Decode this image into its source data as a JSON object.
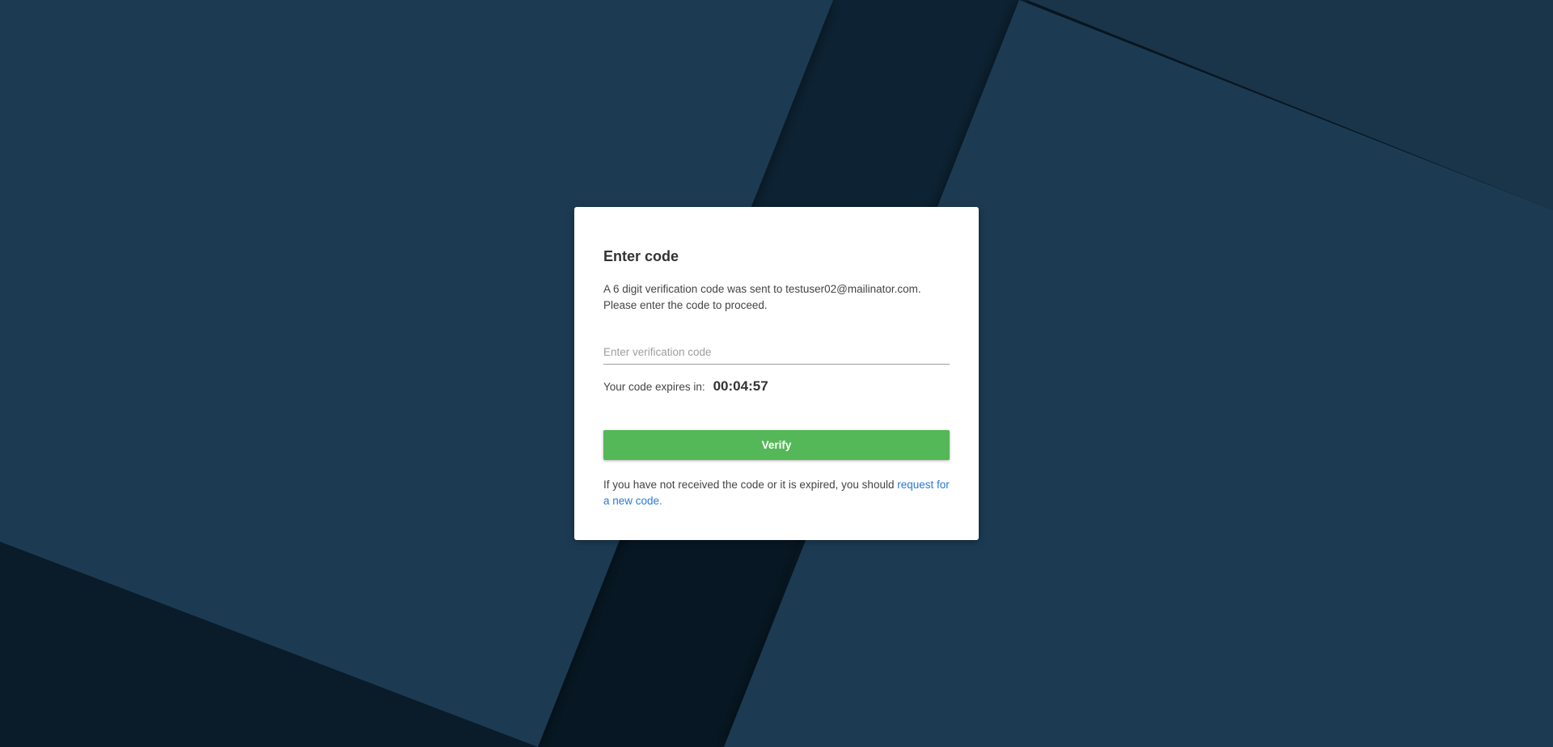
{
  "background": {
    "colors": {
      "base": "#1c3a52",
      "dark": "#0a1c29",
      "darker": "#06131c"
    }
  },
  "verify_card": {
    "title": "Enter code",
    "description_line1": "A 6 digit verification code was sent to testuser02@mailinator.com.",
    "description_line2": "Please enter the code to proceed.",
    "code_input": {
      "placeholder": "Enter verification code",
      "value": ""
    },
    "expires_label": "Your code expires in:",
    "timer": "00:04:57",
    "verify_button_label": "Verify",
    "footnote_text": "If you have not received the code or it is expired, you should ",
    "request_link_label": "request for a new code."
  },
  "colors": {
    "card": "#ffffff",
    "verify_button": "#54b858",
    "link": "#2a7ad2",
    "text": "#444444",
    "heading": "#333333"
  }
}
